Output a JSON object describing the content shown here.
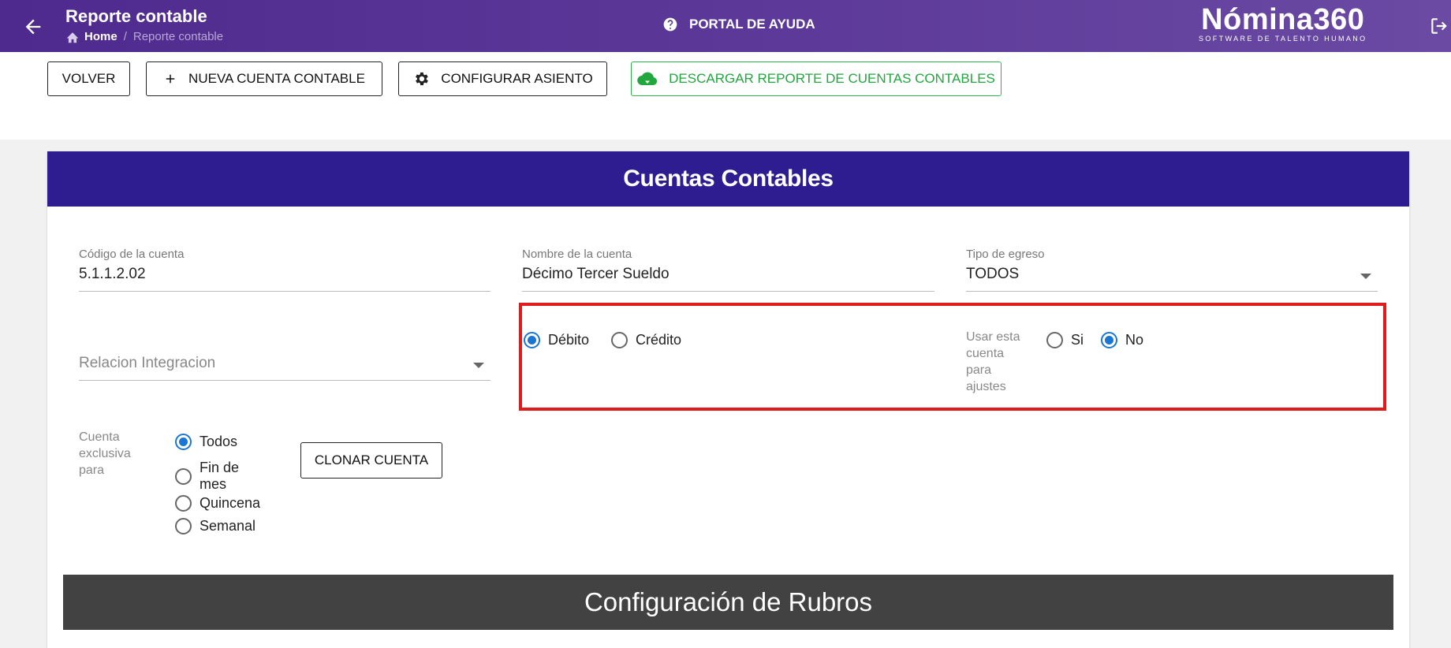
{
  "header": {
    "title": "Reporte contable",
    "breadcrumb": {
      "home": "Home",
      "current": "Reporte contable"
    },
    "help_label": "PORTAL DE AYUDA",
    "logo_brand": "Nómina360",
    "logo_tagline": "SOFTWARE DE TALENTO HUMANO"
  },
  "toolbar": {
    "volver": "VOLVER",
    "nueva": "NUEVA CUENTA CONTABLE",
    "configurar": "CONFIGURAR ASIENTO",
    "descargar": "DESCARGAR REPORTE DE CUENTAS CONTABLES"
  },
  "card": {
    "title": "Cuentas Contables",
    "codigo": {
      "label": "Código de la cuenta",
      "value": "5.1.1.2.02"
    },
    "nombre": {
      "label": "Nombre de la cuenta",
      "value": "Décimo Tercer Sueldo"
    },
    "tipo_egreso": {
      "label": "Tipo de egreso",
      "value": "TODOS"
    },
    "relacion": {
      "placeholder": "Relacion Integracion"
    },
    "debito": "Débito",
    "credito": "Crédito",
    "usar_ajustes_label": [
      "Usar esta",
      "cuenta",
      "para",
      "ajustes"
    ],
    "si": "Si",
    "no": "No",
    "exclusiva_label": [
      "Cuenta",
      "exclusiva",
      "para"
    ],
    "periodos": [
      "Todos",
      "Fin de",
      "mes",
      "Quincena",
      "Semanal"
    ],
    "clonar": "CLONAR CUENTA",
    "rubros_title": "Configuración de Rubros"
  },
  "colors": {
    "topbar": "#5d3a99",
    "card_header": "#2e1c91",
    "accent": "#1976d2",
    "download": "#22a63e",
    "highlight": "#e01b1b"
  }
}
